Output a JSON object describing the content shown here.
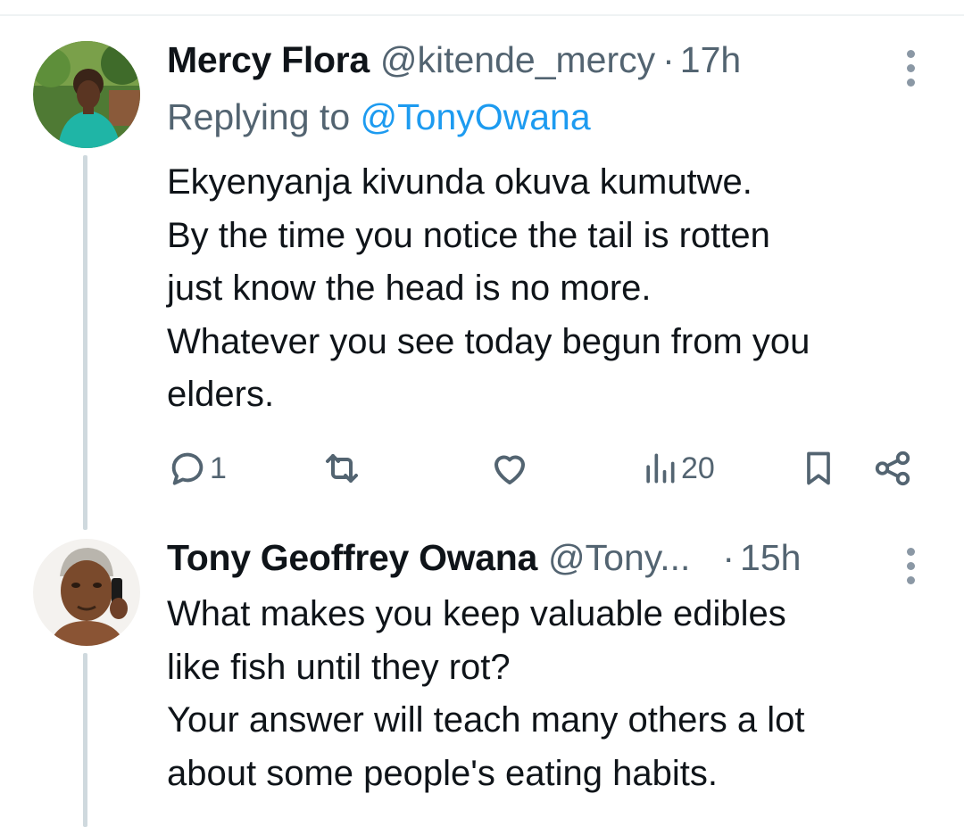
{
  "tweets": [
    {
      "author": {
        "name": "Mercy Flora",
        "handle": "@kitende_mercy"
      },
      "time": "17h",
      "replying_to_label": "Replying to",
      "replying_to_handle": "@TonyOwana",
      "body_lines": [
        "Ekyenyanja kivunda okuva kumutwe.",
        "By the time you notice the tail is rotten",
        "just know the head is no more.",
        "Whatever you see today begun from you",
        "elders."
      ],
      "stats": {
        "replies": "1",
        "views": "20"
      }
    },
    {
      "author": {
        "name": "Tony Geoffrey Owana",
        "handle": "@Tony..."
      },
      "time": "15h",
      "body_lines": [
        "What makes you keep valuable edibles",
        "like fish until they rot?",
        "Your answer will teach many others a lot",
        "about some people's eating habits."
      ]
    }
  ],
  "separator": "·",
  "colors": {
    "text": "#0f1419",
    "secondary": "#536471",
    "link": "#1d9bf0",
    "thread_line": "#cfd9de"
  },
  "icons": [
    "reply-icon",
    "retweet-icon",
    "like-icon",
    "views-icon",
    "bookmark-icon",
    "share-icon",
    "more-icon"
  ]
}
